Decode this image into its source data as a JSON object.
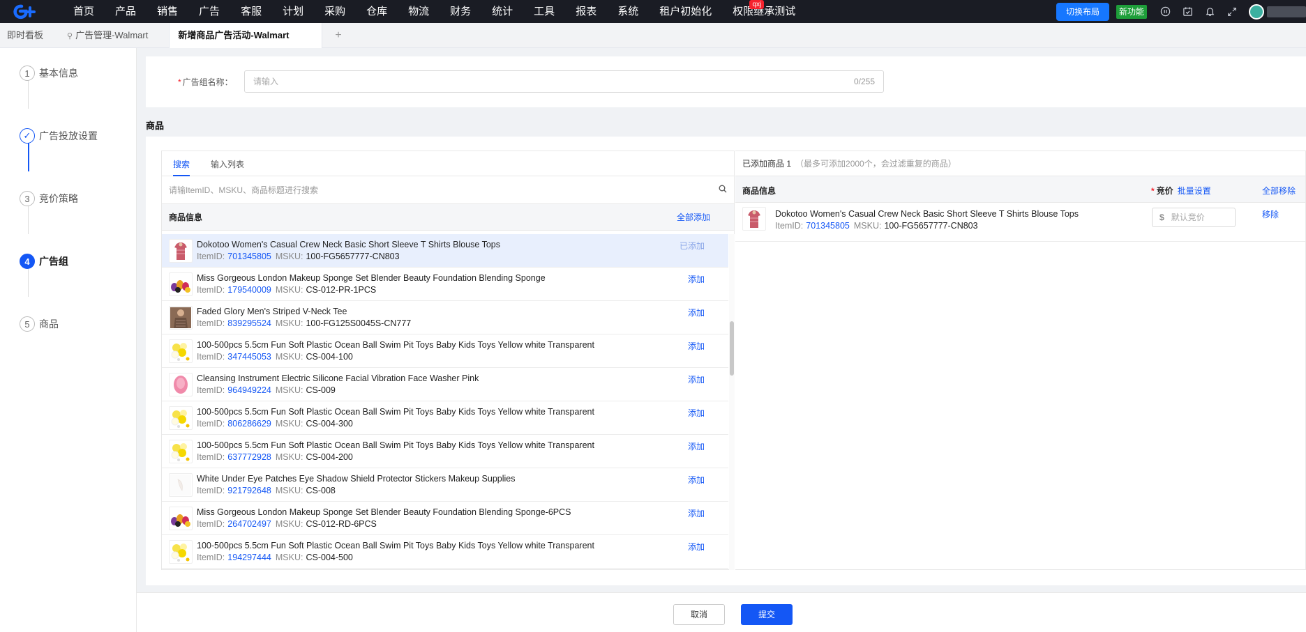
{
  "nav": {
    "items": [
      "首页",
      "产品",
      "销售",
      "广告",
      "客服",
      "计划",
      "采购",
      "仓库",
      "物流",
      "财务",
      "统计",
      "工具",
      "报表",
      "系统",
      "租户初始化",
      "权限继承测试"
    ],
    "badge": "qxj",
    "switch_layout": "切换布局",
    "new_feature": "新功能",
    "icons": [
      "help-icon",
      "calendar-check-icon",
      "bell-icon",
      "fullscreen-icon"
    ]
  },
  "tabs": {
    "items": [
      "即时看板",
      "广告管理-Walmart",
      "新增商品广告活动-Walmart"
    ],
    "add": "+"
  },
  "steps": [
    {
      "num": "1",
      "label": "基本信息",
      "state": "normal"
    },
    {
      "num": "✓",
      "label": "广告投放设置",
      "state": "done"
    },
    {
      "num": "3",
      "label": "竞价策略",
      "state": "normal"
    },
    {
      "num": "4",
      "label": "广告组",
      "state": "active"
    },
    {
      "num": "5",
      "label": "商品",
      "state": "normal"
    }
  ],
  "form": {
    "ad_group_label": "广告组名称：",
    "ad_group_placeholder": "请输入",
    "ad_group_counter": "0/255"
  },
  "section": {
    "title": "商品"
  },
  "left_panel": {
    "tabs": [
      "搜索",
      "输入列表"
    ],
    "search_placeholder": "请输ItemID、MSKU、商品标题进行搜索",
    "header": "商品信息",
    "add_all": "全部添加",
    "itemid_label": "ItemID:",
    "msku_label": "MSKU:",
    "products": [
      {
        "title": "Dokotoo Women's Casual Crew Neck Basic Short Sleeve T Shirts Blouse Tops",
        "item_id": "701345805",
        "msku": "100-FG5657777-CN803",
        "action": "已添加",
        "thumb": "shirt-red"
      },
      {
        "title": "Miss Gorgeous London Makeup Sponge Set Blender Beauty Foundation Blending Sponge",
        "item_id": "179540009",
        "msku": "CS-012-PR-1PCS",
        "action": "添加",
        "thumb": "sponges"
      },
      {
        "title": "Faded Glory Men's Striped V-Neck Tee",
        "item_id": "839295524",
        "msku": "100-FG125S0045S-CN777",
        "action": "添加",
        "thumb": "man-tee"
      },
      {
        "title": "100-500pcs 5.5cm Fun Soft Plastic Ocean Ball Swim Pit Toys Baby Kids Toys Yellow white Transparent",
        "item_id": "347445053",
        "msku": "CS-004-100",
        "action": "添加",
        "thumb": "balls"
      },
      {
        "title": "Cleansing Instrument Electric Silicone Facial Vibration Face Washer Pink",
        "item_id": "964949224",
        "msku": "CS-009",
        "action": "添加",
        "thumb": "pink-brush"
      },
      {
        "title": "100-500pcs 5.5cm Fun Soft Plastic Ocean Ball Swim Pit Toys Baby Kids Toys Yellow white Transparent",
        "item_id": "806286629",
        "msku": "CS-004-300",
        "action": "添加",
        "thumb": "balls"
      },
      {
        "title": "100-500pcs 5.5cm Fun Soft Plastic Ocean Ball Swim Pit Toys Baby Kids Toys Yellow white Transparent",
        "item_id": "637772928",
        "msku": "CS-004-200",
        "action": "添加",
        "thumb": "balls"
      },
      {
        "title": "White Under Eye Patches Eye Shadow Shield Protector Stickers Makeup Supplies",
        "item_id": "921792648",
        "msku": "CS-008",
        "action": "添加",
        "thumb": "patches"
      },
      {
        "title": "Miss Gorgeous London Makeup Sponge Set Blender Beauty Foundation Blending Sponge-6PCS",
        "item_id": "264702497",
        "msku": "CS-012-RD-6PCS",
        "action": "添加",
        "thumb": "sponges"
      },
      {
        "title": "100-500pcs 5.5cm Fun Soft Plastic Ocean Ball Swim Pit Toys Baby Kids Toys Yellow white Transparent",
        "item_id": "194297444",
        "msku": "CS-004-500",
        "action": "添加",
        "thumb": "balls"
      }
    ]
  },
  "right_panel": {
    "added_label": "已添加商品 1",
    "added_hint": "（最多可添加2000个，会过滤重复的商品）",
    "col_info": "商品信息",
    "col_bid": "竞价",
    "bulk_set": "批量设置",
    "remove_all": "全部移除",
    "bid_currency": "$",
    "bid_placeholder": "默认竞价",
    "remove": "移除",
    "product": {
      "title": "Dokotoo Women's Casual Crew Neck Basic Short Sleeve T Shirts Blouse Tops",
      "item_id": "701345805",
      "msku": "100-FG5657777-CN803"
    }
  },
  "footer": {
    "cancel": "取消",
    "submit": "提交"
  },
  "colors": {
    "primary": "#1457f5",
    "nav_bg": "#1a1c24",
    "required": "#f5222d",
    "new_feature": "#1e9e3a"
  }
}
